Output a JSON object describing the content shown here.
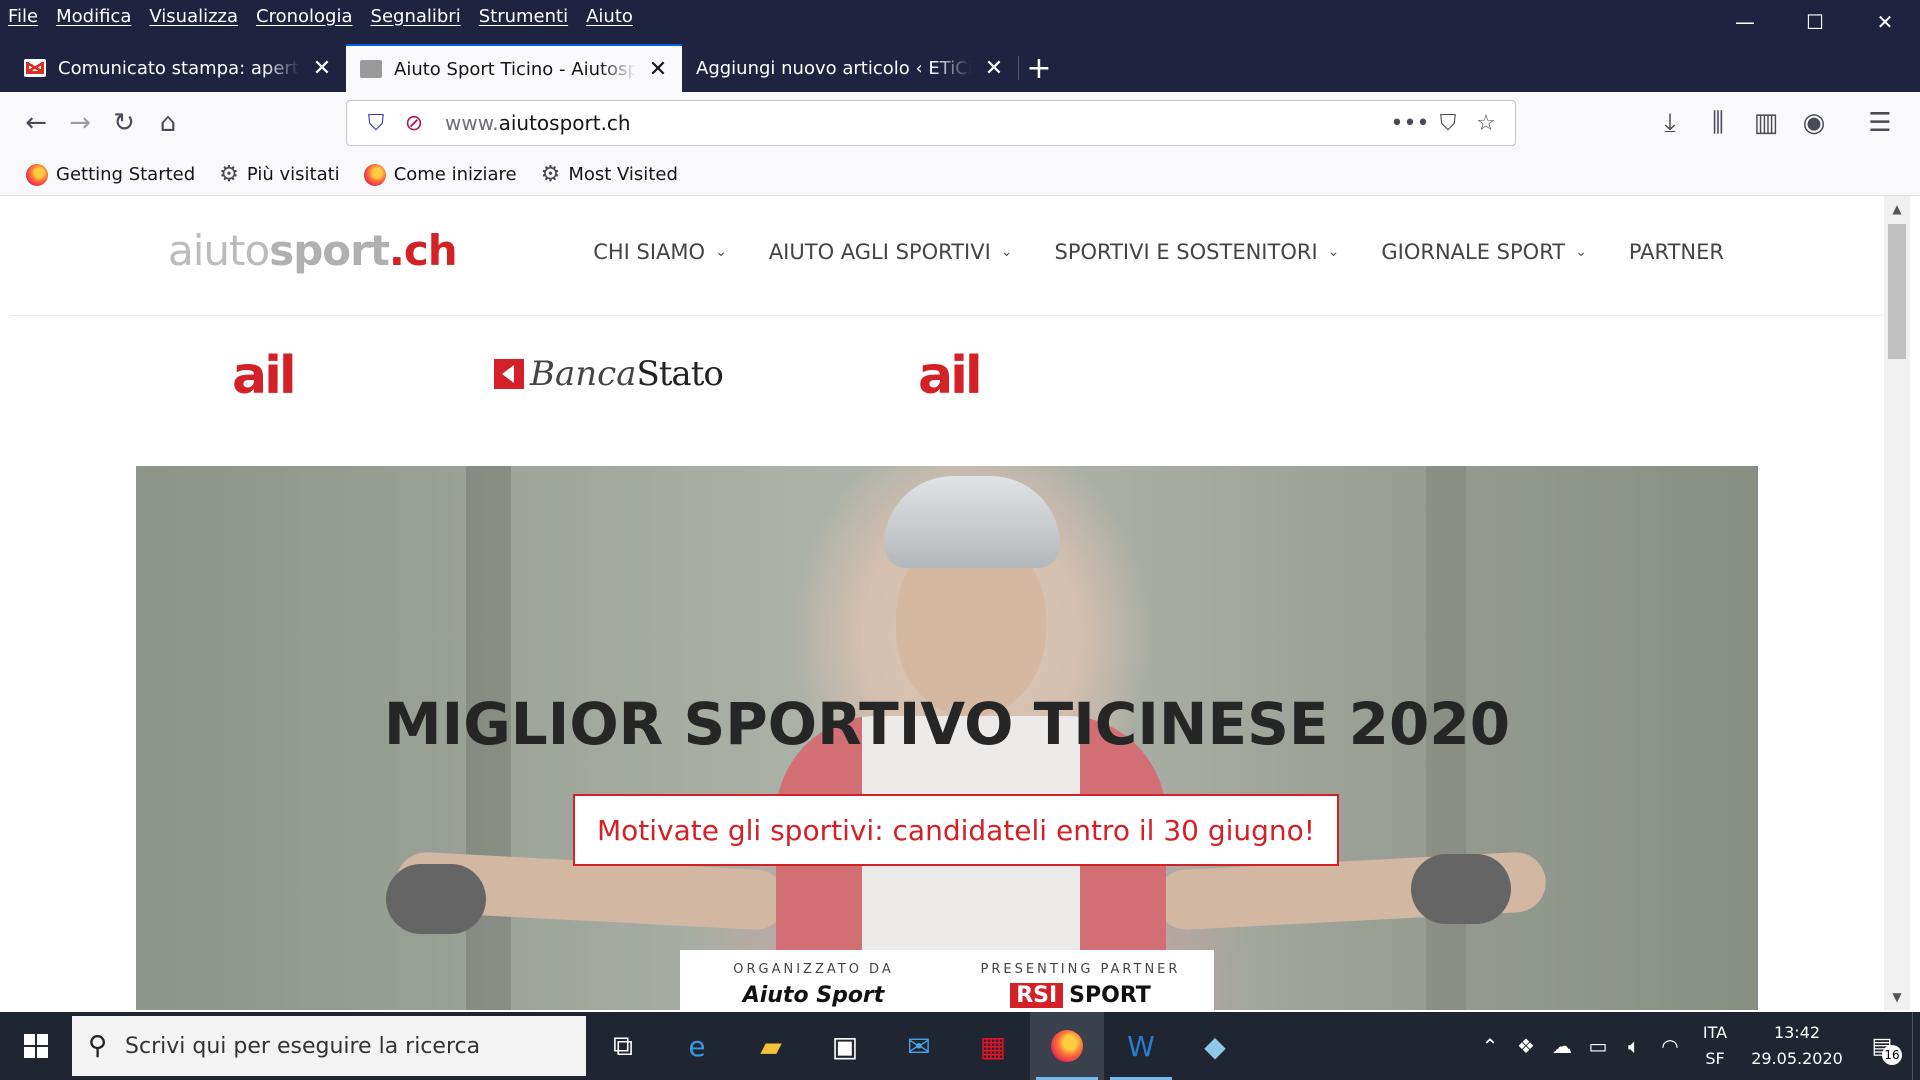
{
  "menubar": [
    "File",
    "Modifica",
    "Visualizza",
    "Cronologia",
    "Segnalibri",
    "Strumenti",
    "Aiuto"
  ],
  "window_controls": {
    "minimize": "—",
    "maximize": "☐",
    "close": "✕"
  },
  "tabs": [
    {
      "title": "Comunicato stampa: aperte le candidature",
      "favicon": "gmail-icon",
      "active": false
    },
    {
      "title": "Aiuto Sport Ticino - Aiutosport.ch",
      "favicon": "site-icon",
      "active": true
    },
    {
      "title": "Aggiungi nuovo articolo ‹ ETiCinforma",
      "favicon": "",
      "active": false
    }
  ],
  "newtab_label": "+",
  "url": {
    "prefix": "www.",
    "domain": "aiutosport.ch"
  },
  "bookmarks": [
    {
      "label": "Getting Started",
      "icon": "firefox-icon"
    },
    {
      "label": "Più visitati",
      "icon": "gear-icon"
    },
    {
      "label": "Come iniziare",
      "icon": "firefox-icon"
    },
    {
      "label": "Most Visited",
      "icon": "gear-icon"
    }
  ],
  "site": {
    "logo": {
      "part1": "aiuto",
      "part2": "sport",
      "part3": ".ch"
    },
    "nav": [
      {
        "label": "CHI SIAMO",
        "dropdown": true
      },
      {
        "label": "AIUTO AGLI SPORTIVI",
        "dropdown": true
      },
      {
        "label": "SPORTIVI E SOSTENITORI",
        "dropdown": true
      },
      {
        "label": "GIORNALE SPORT",
        "dropdown": true
      },
      {
        "label": "PARTNER",
        "dropdown": false
      }
    ],
    "sponsors": {
      "ail1": "ail",
      "banca_part1": "Banca",
      "banca_part2": "Stato",
      "ail2": "ail"
    },
    "hero": {
      "title": "MIGLIOR SPORTIVO TICINESE 2020",
      "cta": "Motivate gli sportivi: candidateli entro il 30 giugno!",
      "organized_label": "ORGANIZZATO DA",
      "organizer": "Aiuto Sport",
      "partner_label": "PRESENTING PARTNER",
      "partner_part1": "RSI",
      "partner_part2": "SPORT"
    }
  },
  "taskbar": {
    "search_placeholder": "Scrivi qui per eseguire la ricerca",
    "lang_line1": "ITA",
    "lang_line2": "SF",
    "time": "13:42",
    "date": "29.05.2020",
    "notifications": "16"
  },
  "colors": {
    "accent": "#d42027",
    "titlebar": "#202340",
    "taskbar": "#1f2631"
  }
}
